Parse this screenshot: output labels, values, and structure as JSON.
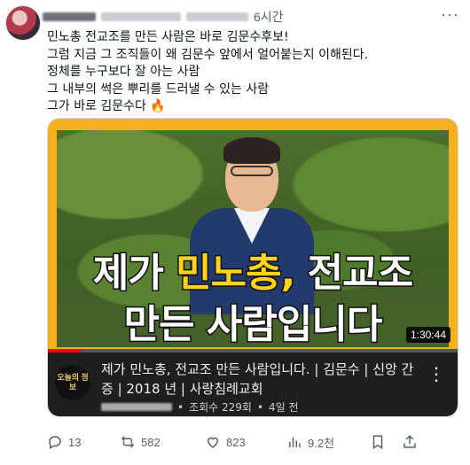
{
  "post": {
    "author_name": "",
    "time": "6시간",
    "more": "···",
    "lines": [
      "민노총 전교조를 만든 사람은 바로 김문수후보!",
      "그럼 지금 그 조직들이 왜 김문수 앞에서 얼어붙는지 이해된다.",
      "정체를 누구보다 잘 아는 사람",
      "그 내부의 썩은 뿌리를 드러낼 수 있는 사람",
      "그가 바로 김문수다 🔥"
    ]
  },
  "video": {
    "caption_line1_a": "제가 ",
    "caption_line1_b": "민노총, ",
    "caption_line1_c": "전교조",
    "caption_line2": "만든 사람입니다",
    "duration": "1:30:44",
    "channel_icon_text": "오늘의 정보",
    "title": "제가 민노총, 전교조 만든 사람입니다. | 김문수 | 신앙 간증 | 2018 년 | 사랑침례교회",
    "views": "조회수 229회",
    "age": "4일 전",
    "separator": "•",
    "more": "⋮"
  },
  "actions": {
    "replies": "13",
    "reposts": "582",
    "likes": "823",
    "views": "9.2천"
  },
  "colors": {
    "accent_orange": "#f5b01e",
    "caption_yellow": "#ffd21e",
    "text_secondary": "#536471"
  }
}
